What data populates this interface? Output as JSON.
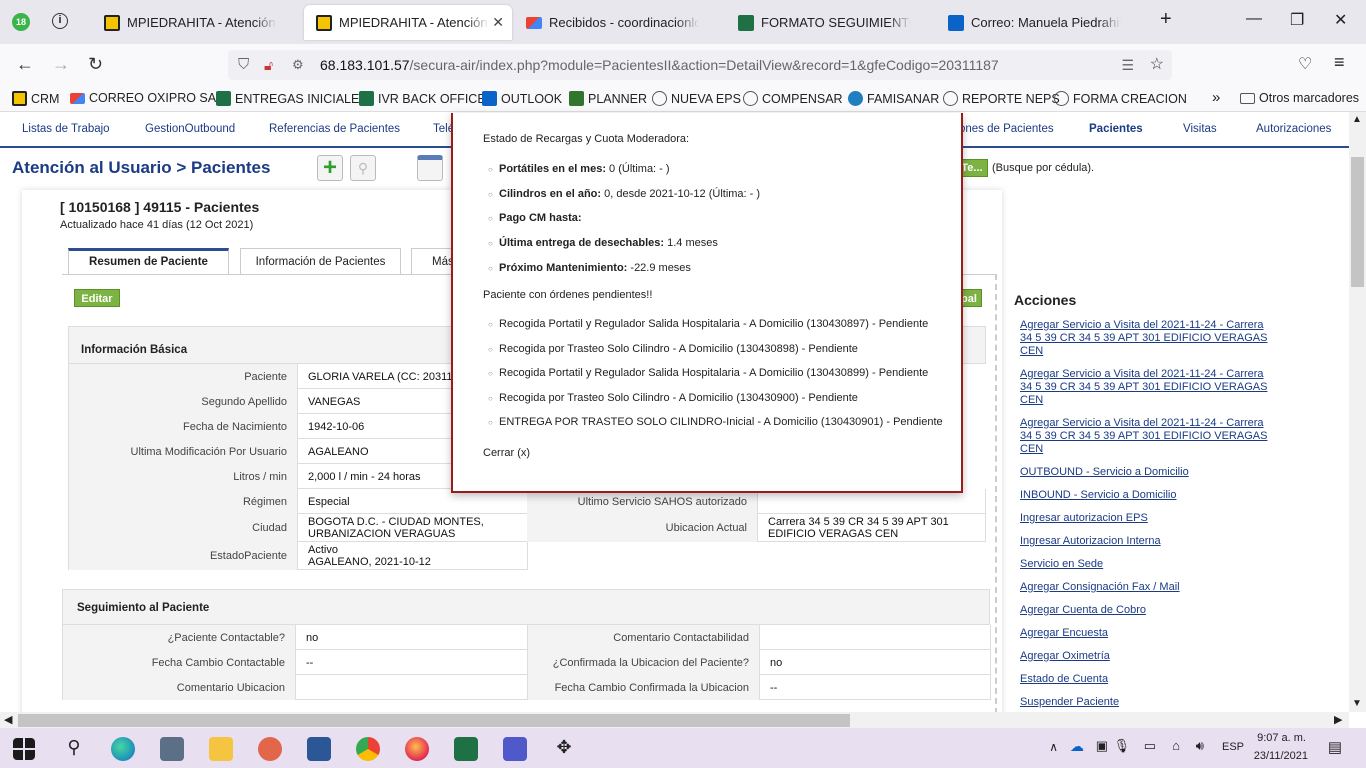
{
  "browser": {
    "tab_count_badge": "18",
    "tabs": [
      {
        "label": "MPIEDRAHITA - Atención al Usuario",
        "icon": "app-icon"
      },
      {
        "label": "MPIEDRAHITA - Atención al Usuario",
        "icon": "app-icon"
      },
      {
        "label": "Recibidos - coordinacionlogistica",
        "icon": "gmail-icon"
      },
      {
        "label": "FORMATO SEGUIMIENTO GD",
        "icon": "excel-icon"
      },
      {
        "label": "Correo: Manuela Piedrahita -",
        "icon": "outlook-icon"
      }
    ],
    "url_host": "68.183.101.57",
    "url_path": "/secura-air/index.php?module=PacientesII&action=DetailView&record=1&gfeCodigo=20311187",
    "bookmarks": [
      "CRM",
      "CORREO OXIPRO SAS",
      "ENTREGAS INICIALES",
      "IVR BACK OFFICE",
      "OUTLOOK",
      "PLANNER",
      "NUEVA EPS",
      "COMPENSAR",
      "FAMISANAR",
      "REPORTE NEPS",
      "FORMA CREACION"
    ],
    "other_bookmarks": "Otros marcadores"
  },
  "modules": {
    "items": [
      "Listas de Trabajo",
      "GestionOutbound",
      "Referencias de Pacientes",
      "Telé",
      "ones de Pacientes",
      "Pacientes",
      "Visitas",
      "Autorizaciones"
    ],
    "selected": "Pacientes"
  },
  "header": {
    "title": "Atención al Usuario > Pacientes",
    "search_button": "Te...",
    "search_hint": "(Busque por cédula)."
  },
  "record": {
    "title": "[ 10150168 ] 49115 - Pacientes",
    "updated": "Actualizado hace 41 días (12 Oct 2021)"
  },
  "detail_tabs": [
    "Resumen de Paciente",
    "Información de Pacientes",
    "Más"
  ],
  "edit_button": "Editar",
  "right_green_button": "pal",
  "basic_info": {
    "title": "Información Básica",
    "rows": [
      {
        "label": "Paciente",
        "value": "GLORIA VARELA (CC: 20311"
      },
      {
        "label": "Segundo Apellido",
        "value": "VANEGAS"
      },
      {
        "label": "Fecha de Nacimiento",
        "value": "1942-10-06"
      },
      {
        "label": "Ultima Modificación Por Usuario",
        "value": "AGALEANO"
      },
      {
        "label": "Litros / min",
        "value": "2,000 l / min - 24 horas"
      },
      {
        "label": "Régimen",
        "value": "Especial"
      },
      {
        "label": "Ciudad",
        "value": "BOGOTA D.C. - CIUDAD MONTES, URBANIZACION VERAGUAS"
      },
      {
        "label": "EstadoPaciente",
        "value": "Activo\nAGALEANO, 2021-10-12"
      }
    ],
    "right_rows": [
      {
        "label": "Ultimo Servicio SAHOS autorizado",
        "value": ""
      },
      {
        "label": "Ubicacion Actual",
        "value": "Carrera 34 5 39 CR 34 5 39 APT 301 EDIFICIO VERAGAS CEN"
      }
    ]
  },
  "followup": {
    "title": "Seguimiento al Paciente",
    "rows": [
      {
        "l1": "¿Paciente Contactable?",
        "v1": "no",
        "l2": "Comentario Contactabilidad",
        "v2": ""
      },
      {
        "l1": "Fecha Cambio Contactable",
        "v1": "--",
        "l2": "¿Confirmada la Ubicacion del Paciente?",
        "v2": "no"
      },
      {
        "l1": "Comentario Ubicacion",
        "v1": "",
        "l2": "Fecha Cambio Confirmada la Ubicacion",
        "v2": "--"
      }
    ]
  },
  "actions": {
    "title": "Acciones",
    "links": [
      "Agregar Servicio a Visita del 2021-11-24 - Carrera 34 5 39 CR 34 5 39 APT 301 EDIFICIO VERAGAS CEN",
      "Agregar Servicio a Visita del 2021-11-24 - Carrera 34 5 39 CR 34 5 39 APT 301 EDIFICIO VERAGAS CEN",
      "Agregar Servicio a Visita del 2021-11-24 - Carrera 34 5 39 CR 34 5 39 APT 301 EDIFICIO VERAGAS CEN",
      "OUTBOUND - Servicio a Domicilio",
      "INBOUND - Servicio a Domicilio",
      "Ingresar autorizacion EPS",
      "Ingresar Autorizacion Interna",
      "Servicio en Sede",
      "Agregar Consignación Fax / Mail",
      "Agregar Cuenta de Cobro",
      "Agregar Encuesta",
      "Agregar Oximetría",
      "Estado de Cuenta",
      "Suspender Paciente"
    ]
  },
  "popup": {
    "heading": "Estado de Recargas y Cuota Moderadora:",
    "items": [
      {
        "k": "Portátiles en el mes:",
        "v": " 0 (Última: - )"
      },
      {
        "k": "Cilindros en el año:",
        "v": " 0, desde 2021-10-12 (Última: - )"
      },
      {
        "k": "Pago CM hasta:",
        "v": ""
      },
      {
        "k": "Última entrega de desechables:",
        "v": " 1.4 meses"
      },
      {
        "k": "Próximo Mantenimiento:",
        "v": " -22.9 meses"
      }
    ],
    "orders_heading": "Paciente con órdenes pendientes!!",
    "orders": [
      "Recogida Portatil y Regulador Salida Hospitalaria - A Domicilio (130430897) - Pendiente",
      "Recogida por Trasteo Solo Cilindro - A Domicilio (130430898) - Pendiente",
      "Recogida Portatil y Regulador Salida Hospitalaria - A Domicilio (130430899) - Pendiente",
      "Recogida por Trasteo Solo Cilindro - A Domicilio (130430900) - Pendiente",
      "ENTREGA POR TRASTEO SOLO CILINDRO-Inicial - A Domicilio (130430901) - Pendiente"
    ],
    "close": "Cerrar (x)"
  },
  "taskbar": {
    "lang": "ESP",
    "time": "9:07 a. m.",
    "date": "23/11/2021"
  }
}
